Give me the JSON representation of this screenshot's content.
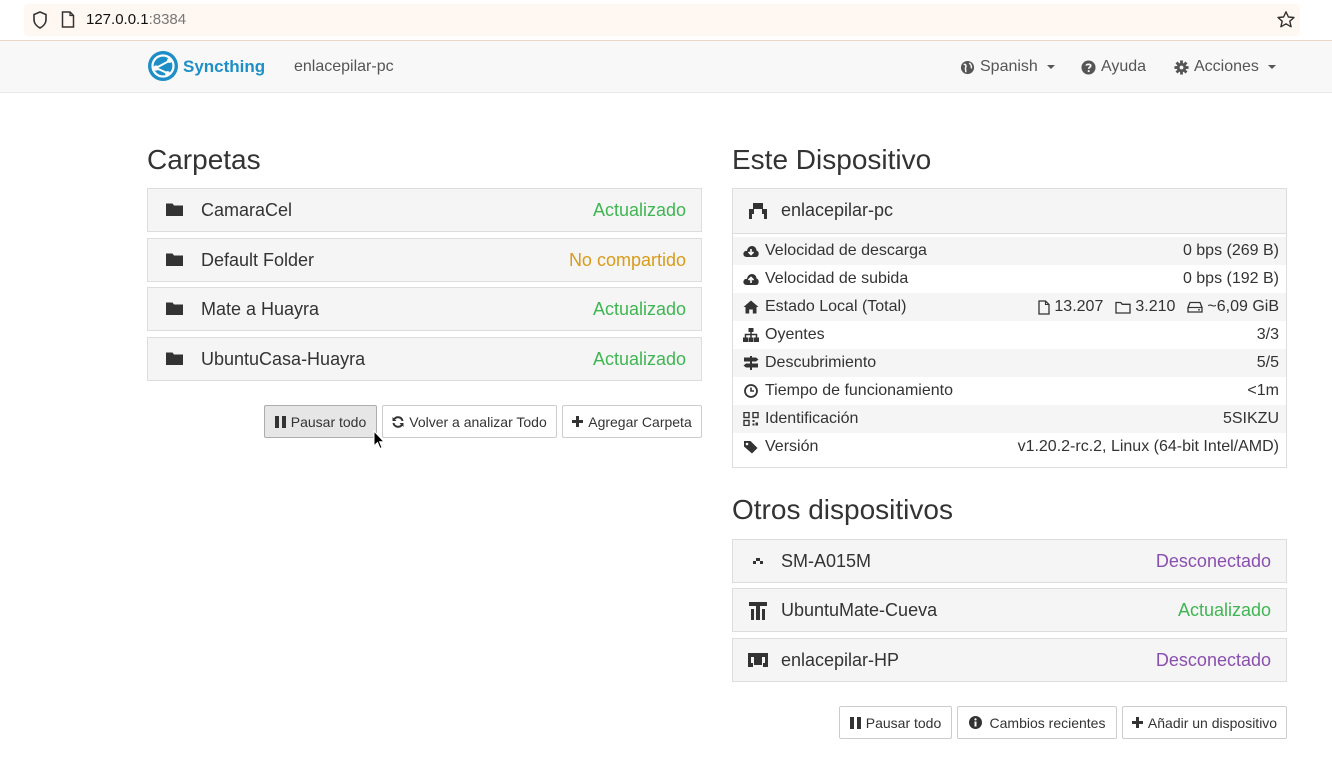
{
  "browser": {
    "url_host": "127.0.0.1",
    "url_port": ":8384"
  },
  "navbar": {
    "brand": "Syncthing",
    "device_name": "enlacepilar-pc",
    "language": "Spanish",
    "help": "Ayuda",
    "actions": "Acciones"
  },
  "folders": {
    "title": "Carpetas",
    "items": [
      {
        "name": "CamaraCel",
        "status": "Actualizado"
      },
      {
        "name": "Default Folder",
        "status": "No compartido"
      },
      {
        "name": "Mate a Huayra",
        "status": "Actualizado"
      },
      {
        "name": "UbuntuCasa-Huayra",
        "status": "Actualizado"
      }
    ],
    "buttons": {
      "pause_all": "Pausar todo",
      "rescan_all": "Volver a analizar Todo",
      "add_folder": "Agregar Carpeta"
    }
  },
  "this_device": {
    "title": "Este Dispositivo",
    "name": "enlacepilar-pc",
    "rows": [
      {
        "label": "Velocidad de descarga",
        "value": "0 bps (269 B)"
      },
      {
        "label": "Velocidad de subida",
        "value": "0 bps (192 B)"
      },
      {
        "label": "Estado Local (Total)",
        "files": "13.207",
        "dirs": "3.210",
        "size": "~6,09 GiB"
      },
      {
        "label": "Oyentes",
        "value": "3/3"
      },
      {
        "label": "Descubrimiento",
        "value": "5/5"
      },
      {
        "label": "Tiempo de funcionamiento",
        "value": "<1m"
      },
      {
        "label": "Identificación",
        "value": "5SIKZU"
      },
      {
        "label": "Versión",
        "value": "v1.20.2-rc.2, Linux (64-bit Intel/AMD)"
      }
    ]
  },
  "other_devices": {
    "title": "Otros dispositivos",
    "items": [
      {
        "name": "SM-A015M",
        "status": "Desconectado"
      },
      {
        "name": "UbuntuMate-Cueva",
        "status": "Actualizado"
      },
      {
        "name": "enlacepilar-HP",
        "status": "Desconectado"
      }
    ],
    "buttons": {
      "pause_all": "Pausar todo",
      "recent_changes": "Cambios recientes",
      "add_device": "Añadir un dispositivo"
    }
  },
  "colors": {
    "up_to_date": "#3fb652",
    "unshared": "#d89b1a",
    "disconnected": "#8a4faf",
    "link": "#2c9fd8",
    "brand": "#1e8fc6"
  }
}
